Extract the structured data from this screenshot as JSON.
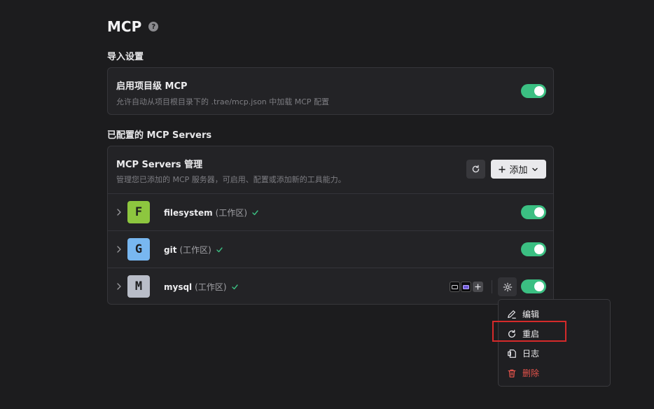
{
  "header": {
    "title": "MCP"
  },
  "import_settings": {
    "heading": "导入设置",
    "project_mcp": {
      "title": "启用项目级 MCP",
      "description": "允许自动从项目根目录下的 .trae/mcp.json 中加载 MCP 配置",
      "enabled": true
    }
  },
  "configured": {
    "heading": "已配置的 MCP Servers",
    "manage": {
      "title": "MCP Servers 管理",
      "description": "管理您已添加的 MCP 服务器，可启用、配置或添加新的工具能力。",
      "add_label": "添加"
    },
    "servers": [
      {
        "letter": "F",
        "name": "filesystem",
        "scope": "(工作区)",
        "color": "#8dc63f",
        "enabled": true
      },
      {
        "letter": "G",
        "name": "git",
        "scope": "(工作区)",
        "color": "#78b7f0",
        "enabled": true
      },
      {
        "letter": "M",
        "name": "mysql",
        "scope": "(工作区)",
        "color": "#b9bdc8",
        "enabled": true
      }
    ]
  },
  "context_menu": {
    "items": [
      {
        "label": "编辑",
        "icon": "edit-icon"
      },
      {
        "label": "重启",
        "icon": "restart-icon"
      },
      {
        "label": "日志",
        "icon": "log-icon"
      },
      {
        "label": "删除",
        "icon": "trash-icon",
        "danger": true
      }
    ]
  },
  "colors": {
    "accent": "#3bbf82",
    "danger": "#e5534b",
    "highlight": "#d52a2a"
  }
}
